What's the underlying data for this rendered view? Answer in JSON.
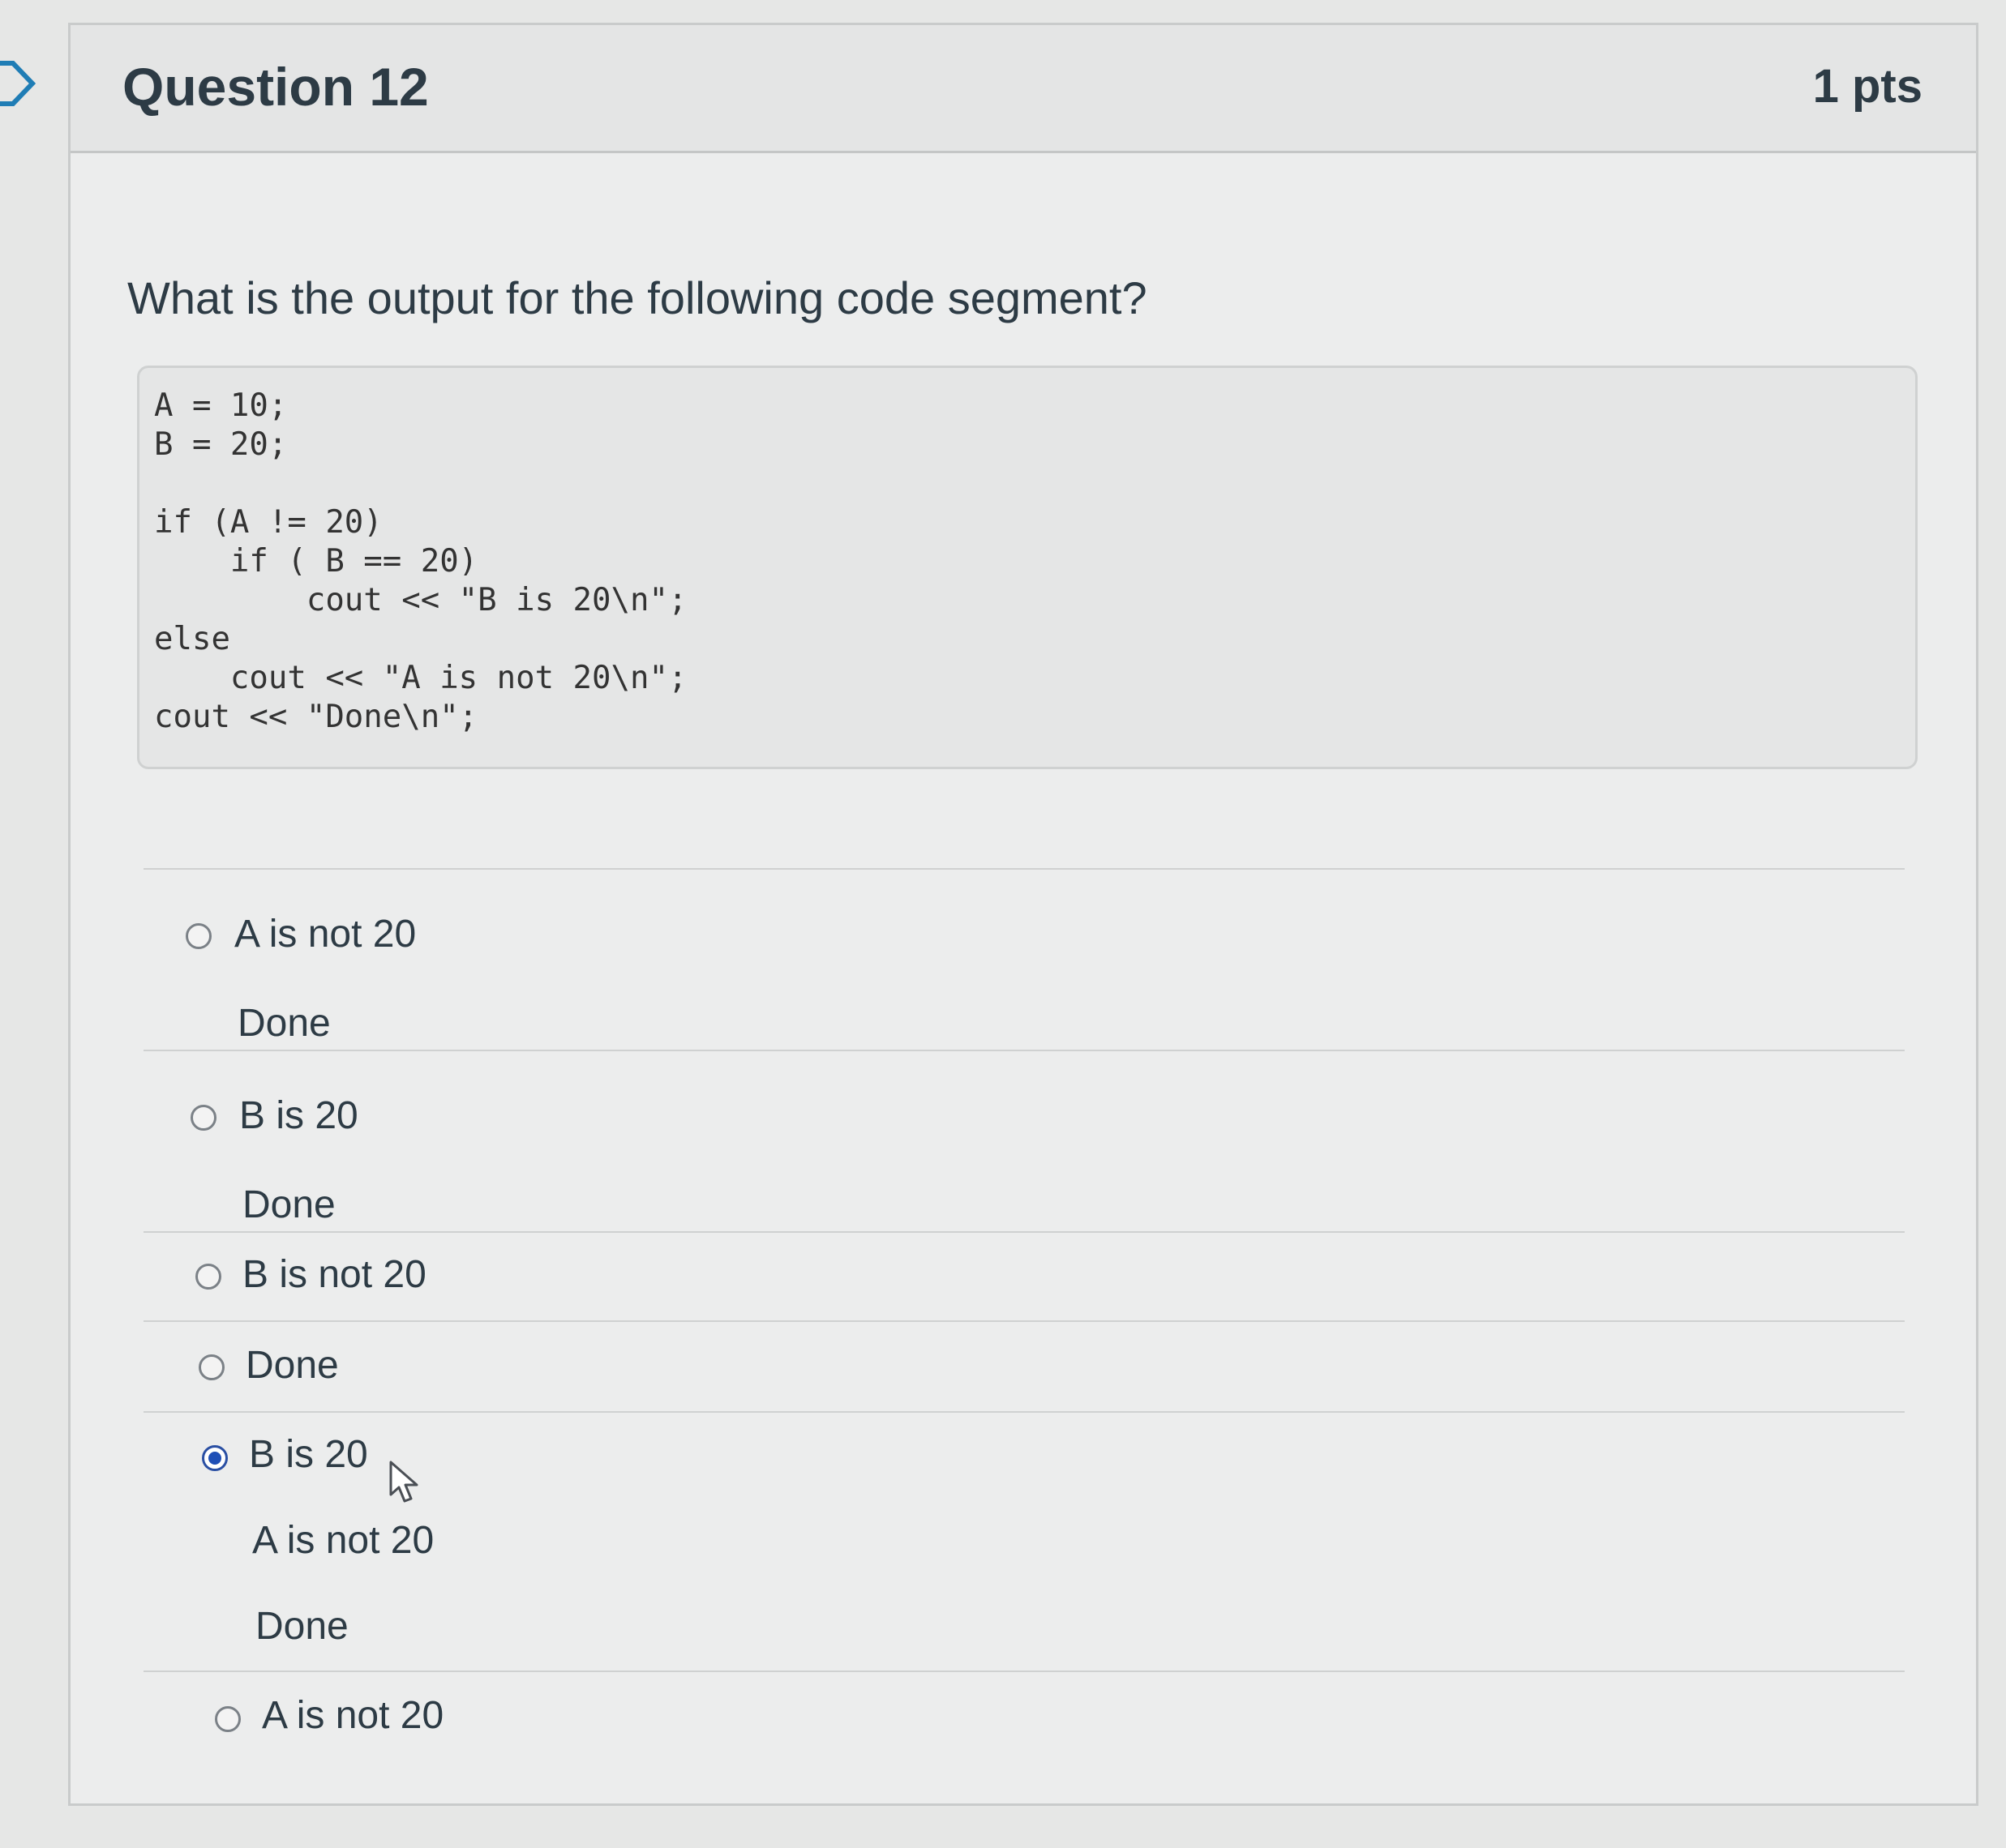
{
  "question": {
    "title": "Question 12",
    "points": "1 pts",
    "prompt": "What is the output for the following code segment?"
  },
  "code": {
    "lines": [
      "A = 10;",
      "B = 20;",
      "",
      "if (A != 20)",
      "    if ( B == 20)",
      "        cout << \"B is 20\\n\";",
      "else",
      "    cout << \"A is not 20\\n\";",
      "cout << \"Done\\n\";"
    ]
  },
  "answers": [
    {
      "lines": [
        "A is not 20",
        "Done"
      ],
      "selected": false
    },
    {
      "lines": [
        "B is 20",
        "Done"
      ],
      "selected": false
    },
    {
      "lines": [
        "B is not 20"
      ],
      "selected": false
    },
    {
      "lines": [
        "Done"
      ],
      "selected": false
    },
    {
      "lines": [
        "B is 20",
        "A is not 20",
        "Done"
      ],
      "selected": true
    },
    {
      "lines": [
        "A is not 20"
      ],
      "selected": false
    }
  ],
  "icons": {
    "flag": "flag-marker-icon",
    "cursor": "mouse-pointer-icon"
  }
}
